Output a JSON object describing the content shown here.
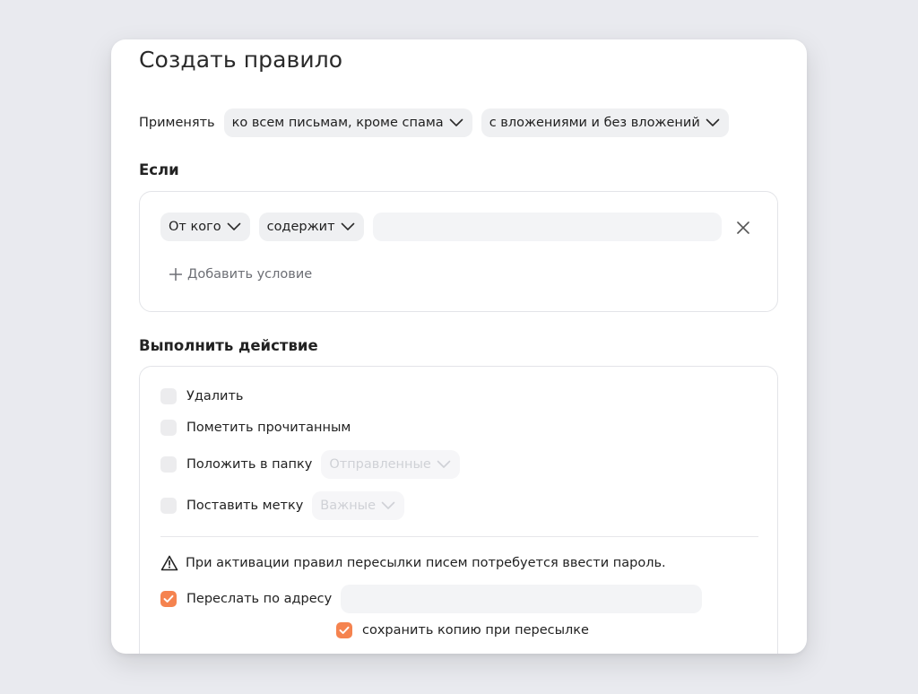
{
  "dialog": {
    "title": "Создать правило",
    "apply": {
      "label": "Применять",
      "scope": "ко всем письмам, кроме спама",
      "attachments": "с вложениями и без вложений"
    },
    "if_section": {
      "heading": "Если",
      "condition": {
        "field": "От кого",
        "operator": "содержит",
        "value": "",
        "remove_icon": "close-icon"
      },
      "add_condition": "Добавить условие"
    },
    "action_section": {
      "heading": "Выполнить действие",
      "delete": {
        "label": "Удалить",
        "checked": false
      },
      "mark_read": {
        "label": "Пометить прочитанным",
        "checked": false
      },
      "move_folder": {
        "label": "Положить в папку",
        "checked": false,
        "folder": "Отправленные"
      },
      "set_label": {
        "label": "Поставить метку",
        "checked": false,
        "tag": "Важные"
      },
      "warning": "При активации правил пересылки писем потребуется ввести пароль.",
      "forward": {
        "label": "Переслать по адресу",
        "checked": true,
        "address": ""
      },
      "keep_copy": {
        "label": "сохранить копию при пересылке",
        "checked": true
      }
    }
  },
  "colors": {
    "background": "#e9eaef",
    "checkbox_checked": "#f5834f",
    "pill_bg": "#eff0f2"
  }
}
